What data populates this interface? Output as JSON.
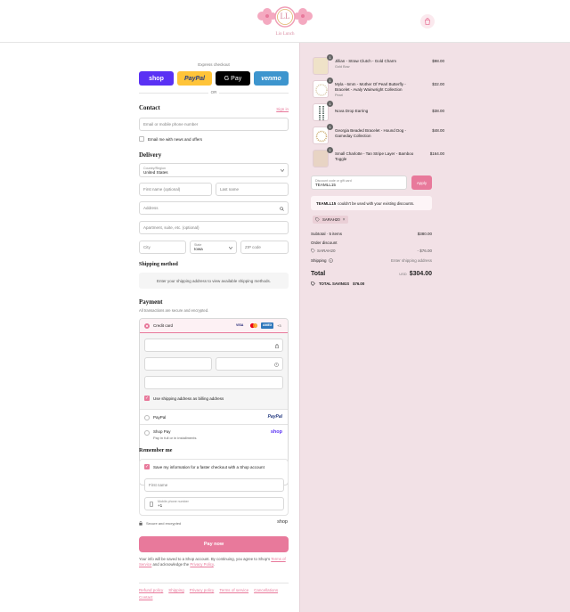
{
  "header": {
    "brand": "Lio Lunch",
    "brand_mark": "LL",
    "cart_icon": "shopping-bag-icon"
  },
  "express": {
    "title": "Express checkout",
    "shop": "shop",
    "paypal": "PayPal",
    "gpay": "G Pay",
    "venmo": "venmo",
    "or": "OR"
  },
  "contact": {
    "title": "Contact",
    "sign_in": "Sign in",
    "email_placeholder": "Email or mobile phone number",
    "news_label": "Email me with news and offers"
  },
  "delivery": {
    "title": "Delivery",
    "country_label": "Country/Region",
    "country_value": "United States",
    "first_name": "First name (optional)",
    "last_name": "Last name",
    "address": "Address",
    "apartment": "Apartment, suite, etc. (optional)",
    "city": "City",
    "state_label": "State",
    "state_value": "Iowa",
    "zip": "ZIP code"
  },
  "shipping": {
    "title": "Shipping method",
    "note": "Enter your shipping address to view available shipping methods."
  },
  "payment": {
    "title": "Payment",
    "subtitle": "All transactions are secure and encrypted.",
    "credit_card": "Credit card",
    "card_logos": [
      "VISA",
      "MC",
      "AMEX",
      "+3"
    ],
    "billing_same": "Use shipping address as billing address",
    "paypal_label": "PayPal",
    "paypal_logo": "PayPal",
    "shoppay_label": "Shop Pay",
    "shoppay_sub": "Pay in full or in installments",
    "shoppay_logo": "shop"
  },
  "remember": {
    "title": "Remember me",
    "save_label": "Save my information for a faster checkout with a Shop account",
    "first_name": "First name",
    "phone_label": "Mobile phone number",
    "phone_value": "+1",
    "secure": "Secure and encrypted",
    "shop_logo": "shop"
  },
  "pay_now": "Pay now",
  "legal": {
    "text1": "Your info will be saved to a Shop account. By continuing, you agree to Shop's",
    "terms": "Terms of Service",
    "text2": "and acknowledge the",
    "privacy": "Privacy Policy",
    "text3": "."
  },
  "footer": [
    "Refund policy",
    "Shipping",
    "Privacy policy",
    "Terms of service",
    "Cancellations",
    "Contact"
  ],
  "summary": {
    "items": [
      {
        "name": "Jillian - Straw Clutch - Gold Charm",
        "variant": "Gold Bow",
        "price": "$98.00",
        "qty": "1"
      },
      {
        "name": "Myla - 6mm - Mother Of Pearl Butterfly - Bracelet - Avaly Wainwright Collection",
        "variant": "Pearl",
        "price": "$32.00",
        "qty": "1"
      },
      {
        "name": "Nova Drop Earring",
        "variant": "",
        "price": "$38.00",
        "qty": "1"
      },
      {
        "name": "Georgia Beaded Bracelet - Hound Dog - Gameday Collection",
        "variant": "",
        "price": "$48.00",
        "qty": "1"
      },
      {
        "name": "Small Charlotte - Tan Stripe Layer - Bamboo Toggle",
        "variant": "",
        "price": "$164.00",
        "qty": "1"
      }
    ],
    "discount_label": "Discount code or gift card",
    "discount_value": "TEAMLL15",
    "apply": "Apply",
    "error_code": "TEAMLL15",
    "error_text": "couldn't be used with your existing discounts.",
    "applied_code": "SARAH20",
    "subtotal_label": "Subtotal · 5 items",
    "subtotal_value": "$380.00",
    "order_discount_label": "Order discount",
    "order_discount_code": "SARAH20",
    "order_discount_value": "- $76.00",
    "shipping_label": "Shipping",
    "shipping_value": "Enter shipping address",
    "total_label": "Total",
    "currency": "USD",
    "total_value": "$304.00",
    "savings_label": "TOTAL SAVINGS",
    "savings_value": "$76.00"
  },
  "colors": {
    "accent": "#e8799b",
    "summary_bg": "#f2e1e6",
    "shop_purple": "#5a31f4",
    "paypal_yellow": "#ffc439",
    "venmo_blue": "#3d95ce"
  }
}
